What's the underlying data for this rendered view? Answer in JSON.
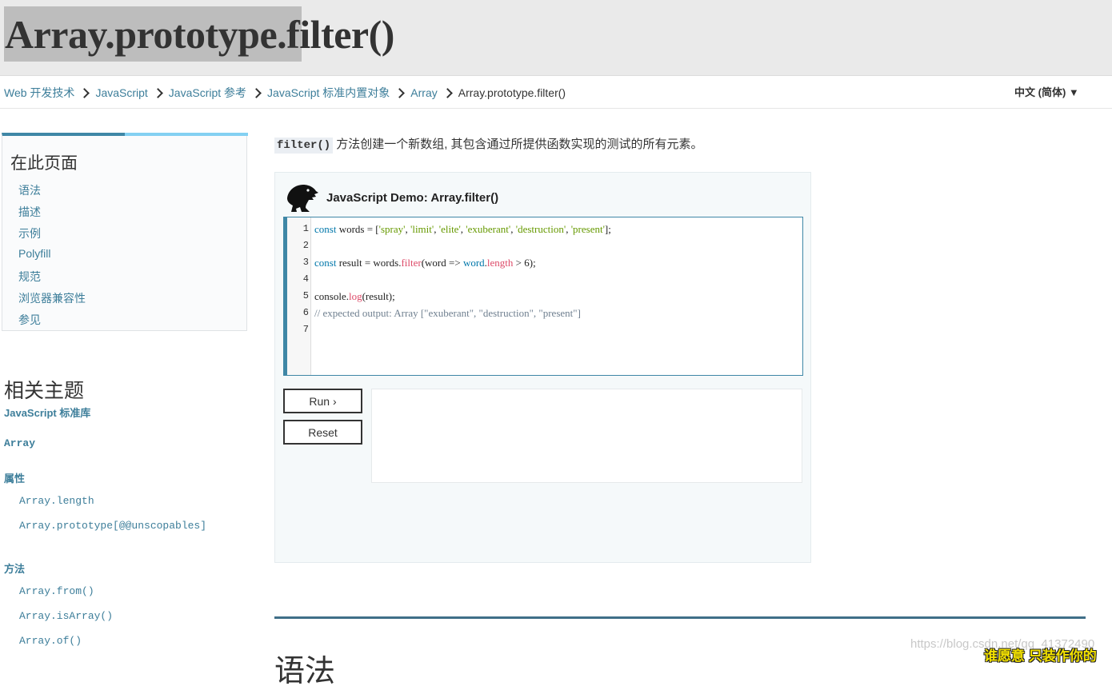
{
  "page": {
    "title_selected": "Array.prototype",
    "title_rest": ".filter()"
  },
  "breadcrumb": [
    "Web 开发技术",
    "JavaScript",
    "JavaScript 参考",
    "JavaScript 标准内置对象",
    "Array",
    "Array.prototype.filter()"
  ],
  "language": "中文 (简体) ▼",
  "toc": {
    "title": "在此页面",
    "items": [
      "语法",
      "描述",
      "示例",
      "Polyfill",
      "规范",
      "浏览器兼容性",
      "参见"
    ]
  },
  "related": {
    "title": "相关主题",
    "stdlib": "JavaScript 标准库",
    "array": "Array",
    "properties_heading": "属性",
    "properties": [
      "Array.length",
      "Array.prototype[@@unscopables]"
    ],
    "methods_heading": "方法",
    "methods": [
      "Array.from()",
      "Array.isArray()",
      "Array.of()"
    ]
  },
  "intro": {
    "code": "filter()",
    "text": "方法创建一个新数组, 其包含通过所提供函数实现的测试的所有元素。"
  },
  "demo": {
    "title": "JavaScript Demo: Array.filter()",
    "line_numbers": [
      "1",
      "2",
      "3",
      "4",
      "5",
      "6",
      "7"
    ],
    "code": {
      "l1": [
        "const",
        " words = [",
        "'spray'",
        ", ",
        "'limit'",
        ", ",
        "'elite'",
        ", ",
        "'exuberant'",
        ", ",
        "'destruction'",
        ", ",
        "'present'",
        "];"
      ],
      "l3": [
        "const",
        " result = words.",
        "filter",
        "(word => ",
        "word",
        ".",
        "length",
        " > 6);"
      ],
      "l5": [
        "console.",
        "log",
        "(result);"
      ],
      "l6": "// expected output: Array [\"exuberant\", \"destruction\", \"present\"]"
    },
    "run_label": "Run ›",
    "reset_label": "Reset"
  },
  "section_peek": "语法",
  "overlay": {
    "watermark": "https://blog.csdn.net/qq_41372490",
    "subtitle": "谁愿意 只装作你的"
  },
  "colors": {
    "link": "#3d7e9a",
    "accent": "#3f87a6",
    "keyword": "#0077aa",
    "string": "#669900",
    "function": "#dd4a68",
    "comment": "#708090"
  }
}
